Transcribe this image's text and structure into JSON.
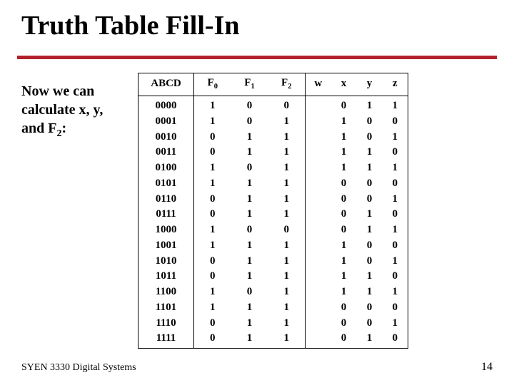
{
  "title": "Truth Table Fill-In",
  "sidetext_l1": "Now we can",
  "sidetext_l2": "calculate x, y,",
  "sidetext_l3": "and F",
  "sidetext_sub": "2",
  "sidetext_after": ":",
  "headers": {
    "abcd": "ABCD",
    "f0_base": "F",
    "f0_sub": "0",
    "f1_base": "F",
    "f1_sub": "1",
    "f2_base": "F",
    "f2_sub": "2",
    "w": "w",
    "x": "x",
    "y": "y",
    "z": "z"
  },
  "chart_data": {
    "type": "table",
    "title": "Truth Table Fill-In",
    "columns": [
      "ABCD",
      "F0",
      "F1",
      "F2",
      "w",
      "x",
      "y",
      "z"
    ],
    "rows": [
      {
        "ABCD": "0000",
        "F0": "1",
        "F1": "0",
        "F2": "0",
        "w": "",
        "x": "0",
        "y": "1",
        "z": "1"
      },
      {
        "ABCD": "0001",
        "F0": "1",
        "F1": "0",
        "F2": "1",
        "w": "",
        "x": "1",
        "y": "0",
        "z": "0"
      },
      {
        "ABCD": "0010",
        "F0": "0",
        "F1": "1",
        "F2": "1",
        "w": "",
        "x": "1",
        "y": "0",
        "z": "1"
      },
      {
        "ABCD": "0011",
        "F0": "0",
        "F1": "1",
        "F2": "1",
        "w": "",
        "x": "1",
        "y": "1",
        "z": "0"
      },
      {
        "ABCD": "0100",
        "F0": "1",
        "F1": "0",
        "F2": "1",
        "w": "",
        "x": "1",
        "y": "1",
        "z": "1"
      },
      {
        "ABCD": "0101",
        "F0": "1",
        "F1": "1",
        "F2": "1",
        "w": "",
        "x": "0",
        "y": "0",
        "z": "0"
      },
      {
        "ABCD": "0110",
        "F0": "0",
        "F1": "1",
        "F2": "1",
        "w": "",
        "x": "0",
        "y": "0",
        "z": "1"
      },
      {
        "ABCD": "0111",
        "F0": "0",
        "F1": "1",
        "F2": "1",
        "w": "",
        "x": "0",
        "y": "1",
        "z": "0"
      },
      {
        "ABCD": "1000",
        "F0": "1",
        "F1": "0",
        "F2": "0",
        "w": "",
        "x": "0",
        "y": "1",
        "z": "1"
      },
      {
        "ABCD": "1001",
        "F0": "1",
        "F1": "1",
        "F2": "1",
        "w": "",
        "x": "1",
        "y": "0",
        "z": "0"
      },
      {
        "ABCD": "1010",
        "F0": "0",
        "F1": "1",
        "F2": "1",
        "w": "",
        "x": "1",
        "y": "0",
        "z": "1"
      },
      {
        "ABCD": "1011",
        "F0": "0",
        "F1": "1",
        "F2": "1",
        "w": "",
        "x": "1",
        "y": "1",
        "z": "0"
      },
      {
        "ABCD": "1100",
        "F0": "1",
        "F1": "0",
        "F2": "1",
        "w": "",
        "x": "1",
        "y": "1",
        "z": "1"
      },
      {
        "ABCD": "1101",
        "F0": "1",
        "F1": "1",
        "F2": "1",
        "w": "",
        "x": "0",
        "y": "0",
        "z": "0"
      },
      {
        "ABCD": "1110",
        "F0": "0",
        "F1": "1",
        "F2": "1",
        "w": "",
        "x": "0",
        "y": "0",
        "z": "1"
      },
      {
        "ABCD": "1111",
        "F0": "0",
        "F1": "1",
        "F2": "1",
        "w": "",
        "x": "0",
        "y": "1",
        "z": "0"
      }
    ]
  },
  "footer_left": "SYEN 3330  Digital Systems",
  "footer_right": "14"
}
